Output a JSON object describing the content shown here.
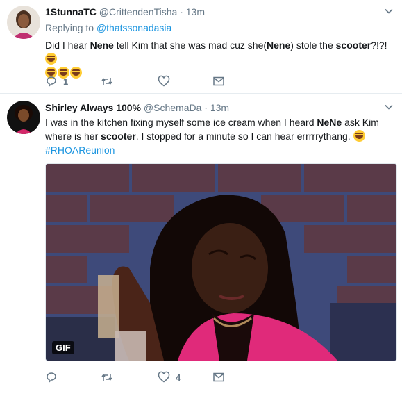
{
  "tweets": [
    {
      "display_name": "1StunnaTC",
      "handle": "@CrittendenTisha",
      "separator": "·",
      "time": "13m",
      "reply_prefix": "Replying to",
      "reply_handle": "@thatssonadasia",
      "text_parts": [
        "Did I hear ",
        "Nene",
        " tell Kim that she was mad cuz she(",
        "Nene",
        ") stole the ",
        "scooter",
        "?!?!"
      ],
      "actions": {
        "reply_count": "1",
        "retweet_count": "",
        "like_count": ""
      }
    },
    {
      "display_name": "Shirley Always 100%",
      "handle": "@SchemaDa",
      "separator": "·",
      "time": "13m",
      "text_parts": [
        "I was in the kitchen  fixing myself some ice cream when I heard ",
        "NeNe",
        " ask Kim where is her ",
        "scooter",
        ". I stopped for a minute so I can hear errrrrythang. "
      ],
      "hashtag": "#RHOAReunion",
      "media_badge": "GIF",
      "actions": {
        "reply_count": "",
        "retweet_count": "",
        "like_count": "4"
      }
    }
  ],
  "colors": {
    "link": "#1b95e0",
    "muted": "#657786",
    "text": "#14171a",
    "divider": "#e6ecf0"
  },
  "icons": [
    "chevron-down-icon",
    "reply-icon",
    "retweet-icon",
    "like-icon",
    "message-icon",
    "laughing-emoji-icon"
  ]
}
